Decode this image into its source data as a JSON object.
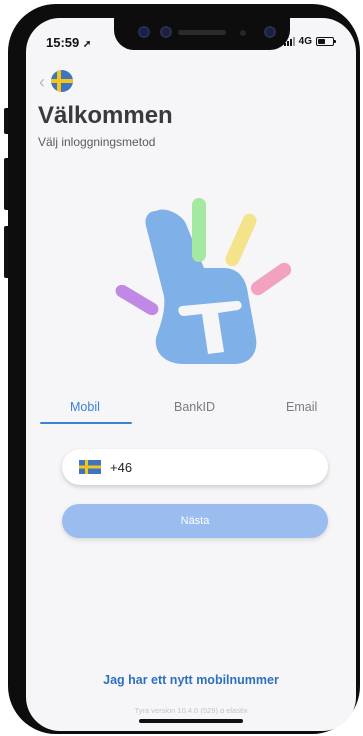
{
  "status_bar": {
    "time": "15:59",
    "network": "4G"
  },
  "header": {
    "title": "Välkommen",
    "subtitle": "Välj inloggningsmetod"
  },
  "tabs": [
    {
      "label": "Mobil",
      "active": true
    },
    {
      "label": "BankID",
      "active": false
    },
    {
      "label": "Email",
      "active": false
    }
  ],
  "phone_input": {
    "country_prefix": "+46",
    "flag": "sweden-flag"
  },
  "next_button": {
    "label": "Nästa"
  },
  "footer": {
    "new_number_link": "Jag har ett nytt mobilnummer",
    "version_text": "Tyra version 10.4.0 (529) ɑ elastix"
  },
  "colors": {
    "accent": "#3a82d7",
    "button": "#9bbcee",
    "link": "#2f6fbe",
    "flag_blue": "#3e75c3",
    "flag_yellow": "#f5c518"
  }
}
